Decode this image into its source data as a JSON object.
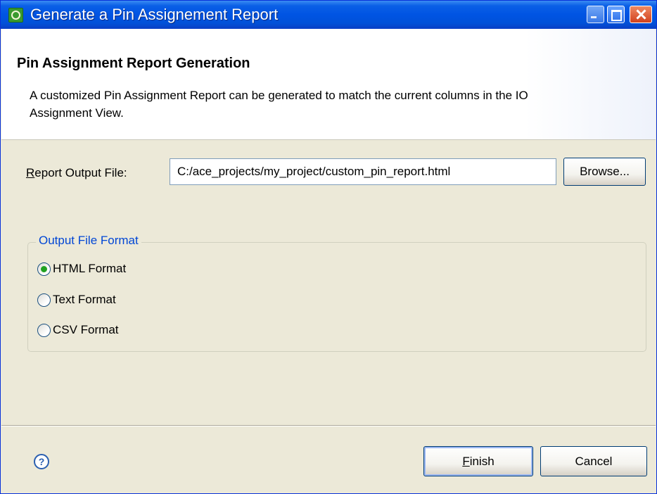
{
  "window": {
    "title": "Generate a Pin Assignement Report"
  },
  "header": {
    "title": "Pin Assignment Report Generation",
    "description": "A customized Pin Assignment Report can be generated to match the current columns in the IO Assignment View."
  },
  "form": {
    "output_label_mnemonic": "R",
    "output_label_rest": "eport Output File:",
    "output_value": "C:/ace_projects/my_project/custom_pin_report.html",
    "browse_label": "Browse..."
  },
  "format_group": {
    "legend": "Output File Format",
    "options": [
      {
        "label": "HTML Format",
        "selected": true
      },
      {
        "label": "Text Format",
        "selected": false
      },
      {
        "label": "CSV Format",
        "selected": false
      }
    ]
  },
  "footer": {
    "help_glyph": "?",
    "finish_mnemonic": "F",
    "finish_rest": "inish",
    "cancel_label": "Cancel"
  }
}
